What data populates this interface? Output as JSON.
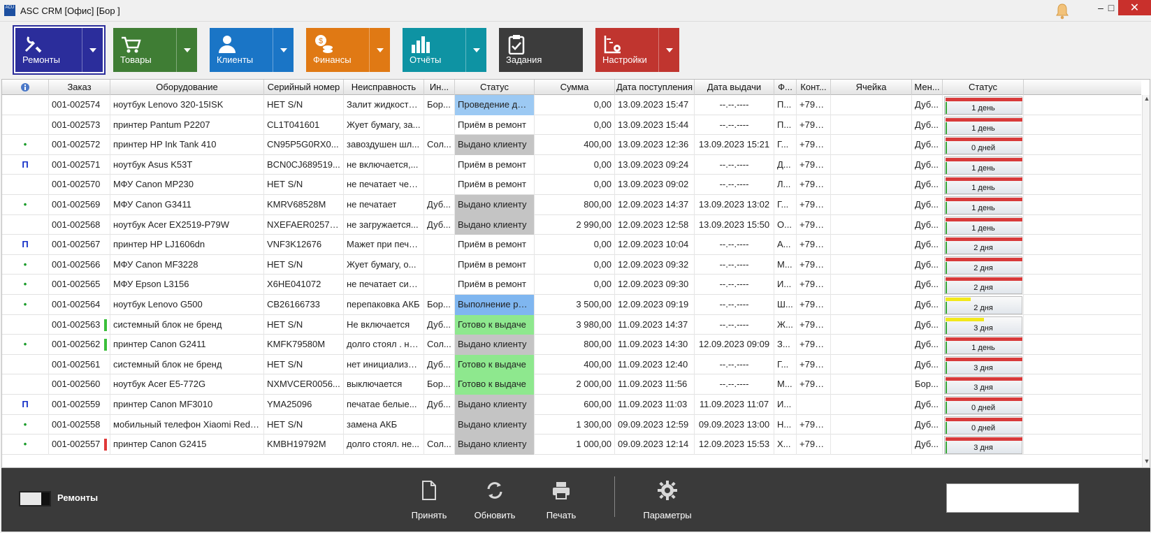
{
  "window": {
    "title": "ASC CRM [Офис] [Бор                ]",
    "app_icon_text": "ACU",
    "controls": {
      "minimize": "‒",
      "maximize": "□",
      "close": "✕"
    }
  },
  "toolbar": [
    {
      "label": "Ремонты",
      "color": "#2b2d9b",
      "icon": "tools-icon",
      "dropdown": true,
      "selected": true
    },
    {
      "label": "Товары",
      "color": "#3f7d34",
      "icon": "cart-icon",
      "dropdown": true,
      "selected": false
    },
    {
      "label": "Клиенты",
      "color": "#1a75c6",
      "icon": "users-icon",
      "dropdown": true,
      "selected": false
    },
    {
      "label": "Финансы",
      "color": "#e07914",
      "icon": "coins-icon",
      "dropdown": true,
      "selected": false
    },
    {
      "label": "Отчёты",
      "color": "#0e93a3",
      "icon": "bar-chart-icon",
      "dropdown": true,
      "selected": false
    },
    {
      "label": "Задания",
      "color": "#3c3c3c",
      "icon": "clipboard-icon",
      "dropdown": false,
      "selected": false
    },
    {
      "label": "Настройки",
      "color": "#c0352f",
      "icon": "settings-chart-icon",
      "dropdown": true,
      "selected": false
    }
  ],
  "columns": [
    "",
    "Заказ",
    "Оборудование",
    "Серийный номер",
    "Неисправность",
    "Ин...",
    "Статус",
    "Сумма",
    "Дата поступления",
    "Дата выдачи",
    "Ф...",
    "Конт...",
    "Ячейка",
    "Мен...",
    "Статус"
  ],
  "rows": [
    {
      "mark": "",
      "order": "001-002574",
      "flag": "",
      "equipment": "ноутбук Lenovo 320-15ISK",
      "serial": "НЕТ S/N",
      "fault": "Залит жидкость...",
      "eng": "Бор...",
      "status": "Проведение диагн",
      "status_class": "blue",
      "sum": "0,00",
      "received": "13.09.2023 15:47",
      "issued": "--.--.----",
      "f": "П...",
      "contact": "+797...",
      "cell": "",
      "manager": "Дуб...",
      "age_label": "1 день",
      "age_fill": 1.0,
      "age_color": "#d83a3a"
    },
    {
      "mark": "",
      "order": "001-002573",
      "flag": "",
      "equipment": "принтер Pantum P2207",
      "serial": "CL1T041601",
      "fault": "Жует бумагу, за...",
      "eng": "",
      "status": "Приём в ремонт",
      "status_class": "",
      "sum": "0,00",
      "received": "13.09.2023 15:44",
      "issued": "--.--.----",
      "f": "П...",
      "contact": "+797...",
      "cell": "",
      "manager": "Дуб...",
      "age_label": "1 день",
      "age_fill": 1.0,
      "age_color": "#d83a3a"
    },
    {
      "mark": "•",
      "order": "001-002572",
      "flag": "",
      "equipment": "принтер HP Ink Tank 410",
      "serial": "CN95P5G0RX0...",
      "fault": "завоздушен шл...",
      "eng": "Сол...",
      "status": "Выдано клиенту",
      "status_class": "gray",
      "sum": "400,00",
      "received": "13.09.2023 12:36",
      "issued": "13.09.2023 15:21",
      "f": "Г...",
      "contact": "+797...",
      "cell": "",
      "manager": "Дуб...",
      "age_label": "0 дней",
      "age_fill": 1.0,
      "age_color": "#d83a3a"
    },
    {
      "mark": "П",
      "order": "001-002571",
      "flag": "",
      "equipment": "ноутбук Asus K53T",
      "serial": "BCN0CJ689519...",
      "fault": "не включается,...",
      "eng": "",
      "status": "Приём в ремонт",
      "status_class": "",
      "sum": "0,00",
      "received": "13.09.2023 09:24",
      "issued": "--.--.----",
      "f": "Д...",
      "contact": "+797...",
      "cell": "",
      "manager": "Дуб...",
      "age_label": "1 день",
      "age_fill": 1.0,
      "age_color": "#d83a3a"
    },
    {
      "mark": "",
      "order": "001-002570",
      "flag": "",
      "equipment": "МФУ Canon MP230",
      "serial": "НЕТ S/N",
      "fault": "не печатает чер...",
      "eng": "",
      "status": "Приём в ремонт",
      "status_class": "",
      "sum": "0,00",
      "received": "13.09.2023 09:02",
      "issued": "--.--.----",
      "f": "Л...",
      "contact": "+797...",
      "cell": "",
      "manager": "Дуб...",
      "age_label": "1 день",
      "age_fill": 1.0,
      "age_color": "#d83a3a"
    },
    {
      "mark": "•",
      "order": "001-002569",
      "flag": "",
      "equipment": "МФУ Canon G3411",
      "serial": "KMRV68528M",
      "fault": "не печатает",
      "eng": "Дуб...",
      "status": "Выдано клиенту",
      "status_class": "gray",
      "sum": "800,00",
      "received": "12.09.2023 14:37",
      "issued": "13.09.2023 13:02",
      "f": "Г...",
      "contact": "+797...",
      "cell": "",
      "manager": "Дуб...",
      "age_label": "1 день",
      "age_fill": 1.0,
      "age_color": "#d83a3a"
    },
    {
      "mark": "",
      "order": "001-002568",
      "flag": "",
      "equipment": "ноутбук Acer EX2519-P79W",
      "serial": "NXEFAER02574...",
      "fault": "не загружается...",
      "eng": "Дуб...",
      "status": "Выдано клиенту",
      "status_class": "gray",
      "sum": "2 990,00",
      "received": "12.09.2023 12:58",
      "issued": "13.09.2023 15:50",
      "f": "О...",
      "contact": "+797...",
      "cell": "",
      "manager": "Дуб...",
      "age_label": "1 день",
      "age_fill": 1.0,
      "age_color": "#d83a3a"
    },
    {
      "mark": "П",
      "order": "001-002567",
      "flag": "",
      "equipment": "принтер HP LJ1606dn",
      "serial": "VNF3K12676",
      "fault": "Мажет при печати",
      "eng": "",
      "status": "Приём в ремонт",
      "status_class": "",
      "sum": "0,00",
      "received": "12.09.2023 10:04",
      "issued": "--.--.----",
      "f": "А...",
      "contact": "+797...",
      "cell": "",
      "manager": "Дуб...",
      "age_label": "2 дня",
      "age_fill": 1.0,
      "age_color": "#d83a3a"
    },
    {
      "mark": "•",
      "order": "001-002566",
      "flag": "",
      "equipment": "МФУ Canon MF3228",
      "serial": "НЕТ S/N",
      "fault": "Жует бумагу, о...",
      "eng": "",
      "status": "Приём в ремонт",
      "status_class": "",
      "sum": "0,00",
      "received": "12.09.2023 09:32",
      "issued": "--.--.----",
      "f": "М...",
      "contact": "+797...",
      "cell": "",
      "manager": "Дуб...",
      "age_label": "2 дня",
      "age_fill": 1.0,
      "age_color": "#d83a3a"
    },
    {
      "mark": "•",
      "order": "001-002565",
      "flag": "",
      "equipment": "МФУ Epson L3156",
      "serial": "X6HE041072",
      "fault": "не печатает син...",
      "eng": "",
      "status": "Приём в ремонт",
      "status_class": "",
      "sum": "0,00",
      "received": "12.09.2023 09:30",
      "issued": "--.--.----",
      "f": "И...",
      "contact": "+797...",
      "cell": "",
      "manager": "Дуб...",
      "age_label": "2 дня",
      "age_fill": 1.0,
      "age_color": "#d83a3a"
    },
    {
      "mark": "•",
      "order": "001-002564",
      "flag": "",
      "equipment": "ноутбук Lenovo G500",
      "serial": "CB26166733",
      "fault": "перепаковка АКБ",
      "eng": "Бор...",
      "status": "Выполнение работ",
      "status_class": "bluework",
      "sum": "3 500,00",
      "received": "12.09.2023 09:19",
      "issued": "--.--.----",
      "f": "Ш...",
      "contact": "+797...",
      "cell": "",
      "manager": "Дуб...",
      "age_label": "2 дня",
      "age_fill": 0.33,
      "age_color": "#f2e81a"
    },
    {
      "mark": "",
      "order": "001-002563",
      "flag": "green",
      "equipment": "системный блок   не бренд",
      "serial": "НЕТ S/N",
      "fault": "Не включается",
      "eng": "Дуб...",
      "status": "Готово к выдаче",
      "status_class": "green",
      "sum": "3 980,00",
      "received": "11.09.2023 14:37",
      "issued": "--.--.----",
      "f": "Ж...",
      "contact": "+799...",
      "cell": "",
      "manager": "Дуб...",
      "age_label": "3 дня",
      "age_fill": 0.5,
      "age_color": "#f2e81a"
    },
    {
      "mark": "•",
      "order": "001-002562",
      "flag": "green",
      "equipment": "принтер Canon G2411",
      "serial": "KMFK79580M",
      "fault": "долго стоял . не...",
      "eng": "Сол...",
      "status": "Выдано клиенту",
      "status_class": "gray",
      "sum": "800,00",
      "received": "11.09.2023 14:30",
      "issued": "12.09.2023 09:09",
      "f": "З...",
      "contact": "+797...",
      "cell": "",
      "manager": "Дуб...",
      "age_label": "1 день",
      "age_fill": 1.0,
      "age_color": "#d83a3a"
    },
    {
      "mark": "",
      "order": "001-002561",
      "flag": "",
      "equipment": "системный блок   не бренд",
      "serial": "НЕТ S/N",
      "fault": "нет инициализа...",
      "eng": "Дуб...",
      "status": "Готово к выдаче",
      "status_class": "green",
      "sum": "400,00",
      "received": "11.09.2023 12:40",
      "issued": "--.--.----",
      "f": "Г...",
      "contact": "+797...",
      "cell": "",
      "manager": "Дуб...",
      "age_label": "3 дня",
      "age_fill": 1.0,
      "age_color": "#d83a3a"
    },
    {
      "mark": "",
      "order": "001-002560",
      "flag": "",
      "equipment": "ноутбук Acer E5-772G",
      "serial": "NXMVCER0056...",
      "fault": "выключается",
      "eng": "Бор...",
      "status": "Готово к выдаче",
      "status_class": "green",
      "sum": "2 000,00",
      "received": "11.09.2023 11:56",
      "issued": "--.--.----",
      "f": "М...",
      "contact": "+797...",
      "cell": "",
      "manager": "Бор...",
      "age_label": "3 дня",
      "age_fill": 1.0,
      "age_color": "#d83a3a"
    },
    {
      "mark": "П",
      "order": "001-002559",
      "flag": "",
      "equipment": "принтер Canon MF3010",
      "serial": "YMA25096",
      "fault": "печатае белые...",
      "eng": "Дуб...",
      "status": "Выдано клиенту",
      "status_class": "gray",
      "sum": "600,00",
      "received": "11.09.2023 11:03",
      "issued": "11.09.2023 11:07",
      "f": "И...",
      "contact": "",
      "cell": "",
      "manager": "Дуб...",
      "age_label": "0 дней",
      "age_fill": 1.0,
      "age_color": "#d83a3a"
    },
    {
      "mark": "•",
      "order": "001-002558",
      "flag": "",
      "equipment": "мобильный телефон Xiaomi Redm...",
      "serial": "НЕТ S/N",
      "fault": "замена АКБ",
      "eng": "",
      "status": "Выдано клиенту",
      "status_class": "gray",
      "sum": "1 300,00",
      "received": "09.09.2023 12:59",
      "issued": "09.09.2023 13:00",
      "f": "Н...",
      "contact": "+797...",
      "cell": "",
      "manager": "Дуб...",
      "age_label": "0 дней",
      "age_fill": 1.0,
      "age_color": "#d83a3a"
    },
    {
      "mark": "•",
      "order": "001-002557",
      "flag": "red",
      "equipment": "принтер Canon G2415",
      "serial": "KMBH19792M",
      "fault": "долго стоял. не...",
      "eng": "Сол...",
      "status": "Выдано клиенту",
      "status_class": "gray",
      "sum": "1 000,00",
      "received": "09.09.2023 12:14",
      "issued": "12.09.2023 15:53",
      "f": "Х...",
      "contact": "+797...",
      "cell": "",
      "manager": "Дуб...",
      "age_label": "3 дня",
      "age_fill": 1.0,
      "age_color": "#d83a3a"
    }
  ],
  "footer": {
    "switch_label": "Ремонты",
    "buttons": [
      {
        "label": "Принять",
        "icon": "new-document-icon"
      },
      {
        "label": "Обновить",
        "icon": "refresh-icon"
      },
      {
        "label": "Печать",
        "icon": "printer-icon"
      },
      {
        "label": "Параметры",
        "icon": "gear-icon"
      }
    ],
    "search_value": ""
  }
}
